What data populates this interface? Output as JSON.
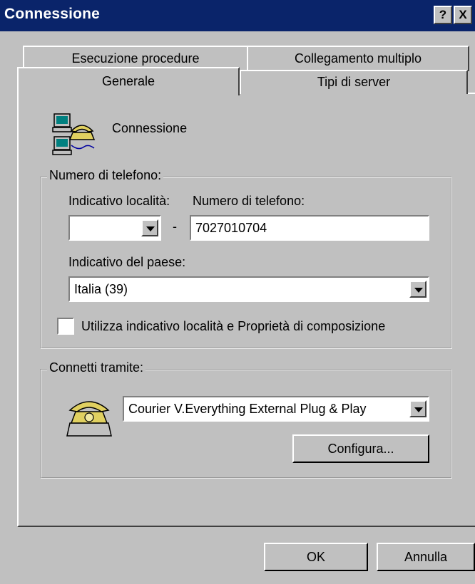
{
  "window": {
    "title": "Connessione"
  },
  "title_buttons": {
    "help": "?",
    "close": "X"
  },
  "tabs": {
    "back": [
      {
        "label": "Esecuzione procedure"
      },
      {
        "label": "Collegamento multiplo"
      }
    ],
    "front": [
      {
        "label": "Generale"
      },
      {
        "label": "Tipi di server"
      }
    ]
  },
  "header": {
    "connection_name": "Connessione"
  },
  "phone_group": {
    "title": "Numero di telefono:",
    "area_code_label": "Indicativo località:",
    "area_code_value": "",
    "separator": "-",
    "phone_label": "Numero di telefono:",
    "phone_value": "7027010704",
    "country_label": "Indicativo del paese:",
    "country_value": "Italia (39)",
    "checkbox_label": "Utilizza indicativo località e Proprietà di composizione",
    "checkbox_checked": false
  },
  "connect_group": {
    "title": "Connetti tramite:",
    "modem_value": "Courier V.Everything External Plug & Play",
    "configure_label": "Configura..."
  },
  "footer": {
    "ok_label": "OK",
    "cancel_label": "Annulla"
  }
}
